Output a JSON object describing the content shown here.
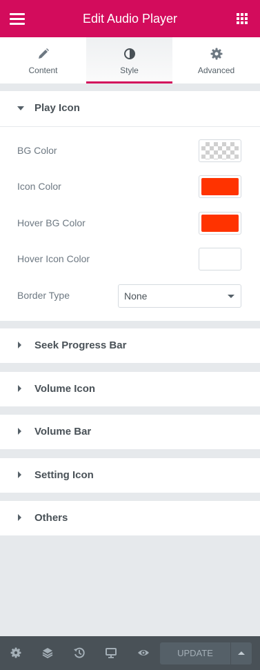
{
  "header": {
    "title": "Edit Audio Player",
    "menu_icon": "hamburger-icon",
    "apps_icon": "grid-icon"
  },
  "tabs": [
    {
      "label": "Content",
      "icon": "pencil-icon",
      "active": false
    },
    {
      "label": "Style",
      "icon": "contrast-icon",
      "active": true
    },
    {
      "label": "Advanced",
      "icon": "gear-icon",
      "active": false
    }
  ],
  "play_icon": {
    "title": "Play Icon",
    "controls": {
      "bg_color": {
        "label": "BG Color",
        "value": "transparent"
      },
      "icon_color": {
        "label": "Icon Color",
        "value": "#ff3300"
      },
      "hover_bg_color": {
        "label": "Hover BG Color",
        "value": "#ff3300"
      },
      "hover_icon_color": {
        "label": "Hover Icon Color",
        "value": "#ffffff"
      },
      "border_type": {
        "label": "Border Type",
        "value": "None"
      }
    }
  },
  "sections": [
    {
      "title": "Seek Progress Bar"
    },
    {
      "title": "Volume Icon"
    },
    {
      "title": "Volume Bar"
    },
    {
      "title": "Setting Icon"
    },
    {
      "title": "Others"
    }
  ],
  "footer": {
    "icons": [
      "gear-icon",
      "layers-icon",
      "history-icon",
      "desktop-icon",
      "eye-icon"
    ],
    "update_label": "UPDATE"
  },
  "colors": {
    "accent": "#d30c5c",
    "footer": "#495157",
    "panel_bg": "#e6e9ec"
  }
}
